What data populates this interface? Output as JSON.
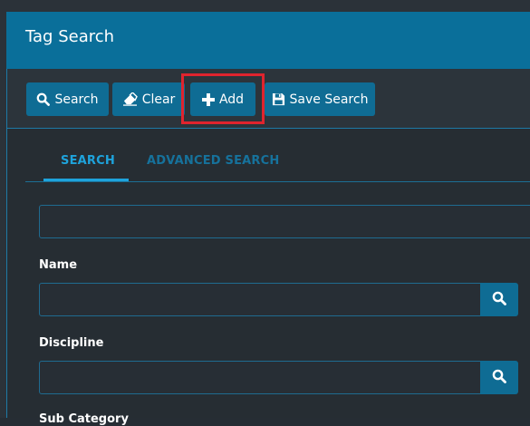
{
  "panel": {
    "title": "Tag Search"
  },
  "toolbar": {
    "search_label": "Search",
    "clear_label": "Clear",
    "add_label": "Add",
    "save_search_label": "Save Search"
  },
  "tabs": [
    {
      "label": "SEARCH",
      "active": true
    },
    {
      "label": "ADVANCED SEARCH",
      "active": false
    }
  ],
  "form": {
    "general_input": {
      "value": "",
      "placeholder": ""
    },
    "fields": [
      {
        "label": "Name",
        "value": "",
        "placeholder": ""
      },
      {
        "label": "Discipline",
        "value": "",
        "placeholder": ""
      },
      {
        "label": "Sub Category",
        "value": "",
        "placeholder": ""
      }
    ]
  },
  "icons": {
    "search": "search-icon",
    "clear": "eraser-icon",
    "add": "plus-icon",
    "save": "floppy-disk-icon",
    "field_search": "search-icon"
  },
  "colors": {
    "accent": "#0a6f9a",
    "button": "#0f6c94",
    "active_tab": "#1ea3dc",
    "highlight": "#e0242e",
    "background": "#262d33"
  }
}
